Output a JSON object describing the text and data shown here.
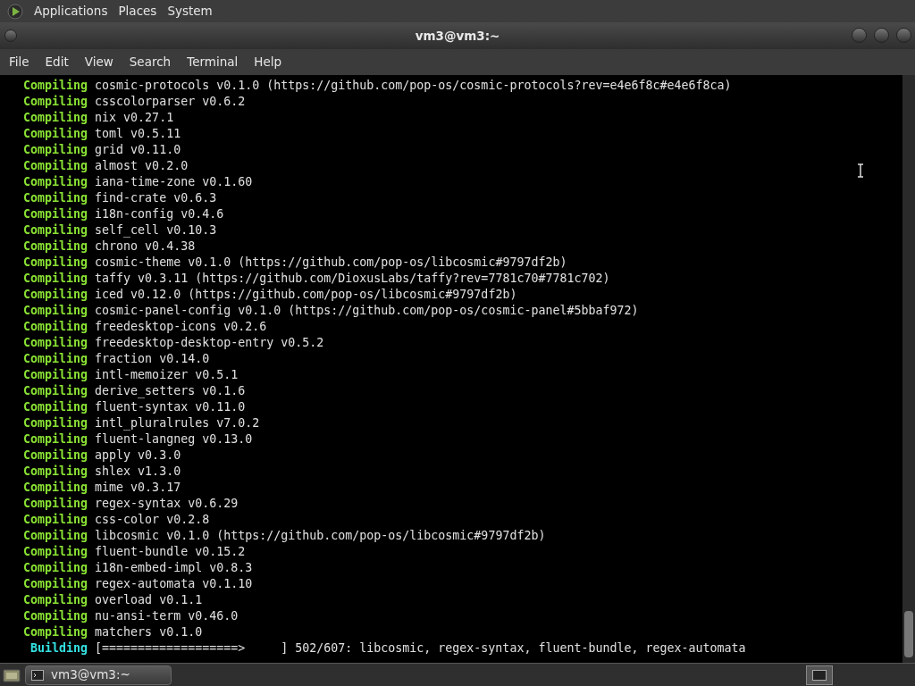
{
  "top_panel": {
    "menus": [
      "Applications",
      "Places",
      "System"
    ]
  },
  "window": {
    "title": "vm3@vm3:~"
  },
  "menu_bar": [
    "File",
    "Edit",
    "View",
    "Search",
    "Terminal",
    "Help"
  ],
  "terminal": {
    "lines": [
      {
        "kind": "compiling",
        "status": "Compiling",
        "text": "cosmic-protocols v0.1.0 (https://github.com/pop-os/cosmic-protocols?rev=e4e6f8c#e4e6f8ca)"
      },
      {
        "kind": "compiling",
        "status": "Compiling",
        "text": "csscolorparser v0.6.2"
      },
      {
        "kind": "compiling",
        "status": "Compiling",
        "text": "nix v0.27.1"
      },
      {
        "kind": "compiling",
        "status": "Compiling",
        "text": "toml v0.5.11"
      },
      {
        "kind": "compiling",
        "status": "Compiling",
        "text": "grid v0.11.0"
      },
      {
        "kind": "compiling",
        "status": "Compiling",
        "text": "almost v0.2.0"
      },
      {
        "kind": "compiling",
        "status": "Compiling",
        "text": "iana-time-zone v0.1.60"
      },
      {
        "kind": "compiling",
        "status": "Compiling",
        "text": "find-crate v0.6.3"
      },
      {
        "kind": "compiling",
        "status": "Compiling",
        "text": "i18n-config v0.4.6"
      },
      {
        "kind": "compiling",
        "status": "Compiling",
        "text": "self_cell v0.10.3"
      },
      {
        "kind": "compiling",
        "status": "Compiling",
        "text": "chrono v0.4.38"
      },
      {
        "kind": "compiling",
        "status": "Compiling",
        "text": "cosmic-theme v0.1.0 (https://github.com/pop-os/libcosmic#9797df2b)"
      },
      {
        "kind": "compiling",
        "status": "Compiling",
        "text": "taffy v0.3.11 (https://github.com/DioxusLabs/taffy?rev=7781c70#7781c702)"
      },
      {
        "kind": "compiling",
        "status": "Compiling",
        "text": "iced v0.12.0 (https://github.com/pop-os/libcosmic#9797df2b)"
      },
      {
        "kind": "compiling",
        "status": "Compiling",
        "text": "cosmic-panel-config v0.1.0 (https://github.com/pop-os/cosmic-panel#5bbaf972)"
      },
      {
        "kind": "compiling",
        "status": "Compiling",
        "text": "freedesktop-icons v0.2.6"
      },
      {
        "kind": "compiling",
        "status": "Compiling",
        "text": "freedesktop-desktop-entry v0.5.2"
      },
      {
        "kind": "compiling",
        "status": "Compiling",
        "text": "fraction v0.14.0"
      },
      {
        "kind": "compiling",
        "status": "Compiling",
        "text": "intl-memoizer v0.5.1"
      },
      {
        "kind": "compiling",
        "status": "Compiling",
        "text": "derive_setters v0.1.6"
      },
      {
        "kind": "compiling",
        "status": "Compiling",
        "text": "fluent-syntax v0.11.0"
      },
      {
        "kind": "compiling",
        "status": "Compiling",
        "text": "intl_pluralrules v7.0.2"
      },
      {
        "kind": "compiling",
        "status": "Compiling",
        "text": "fluent-langneg v0.13.0"
      },
      {
        "kind": "compiling",
        "status": "Compiling",
        "text": "apply v0.3.0"
      },
      {
        "kind": "compiling",
        "status": "Compiling",
        "text": "shlex v1.3.0"
      },
      {
        "kind": "compiling",
        "status": "Compiling",
        "text": "mime v0.3.17"
      },
      {
        "kind": "compiling",
        "status": "Compiling",
        "text": "regex-syntax v0.6.29"
      },
      {
        "kind": "compiling",
        "status": "Compiling",
        "text": "css-color v0.2.8"
      },
      {
        "kind": "compiling",
        "status": "Compiling",
        "text": "libcosmic v0.1.0 (https://github.com/pop-os/libcosmic#9797df2b)"
      },
      {
        "kind": "compiling",
        "status": "Compiling",
        "text": "fluent-bundle v0.15.2"
      },
      {
        "kind": "compiling",
        "status": "Compiling",
        "text": "i18n-embed-impl v0.8.3"
      },
      {
        "kind": "compiling",
        "status": "Compiling",
        "text": "regex-automata v0.1.10"
      },
      {
        "kind": "compiling",
        "status": "Compiling",
        "text": "overload v0.1.1"
      },
      {
        "kind": "compiling",
        "status": "Compiling",
        "text": "nu-ansi-term v0.46.0"
      },
      {
        "kind": "compiling",
        "status": "Compiling",
        "text": "matchers v0.1.0"
      },
      {
        "kind": "building",
        "status": "Building",
        "text": "[===================>     ] 502/607: libcosmic, regex-syntax, fluent-bundle, regex-automata"
      }
    ]
  },
  "taskbar": {
    "tasks": [
      {
        "label": "vm3@vm3:~",
        "selected": true
      }
    ]
  }
}
